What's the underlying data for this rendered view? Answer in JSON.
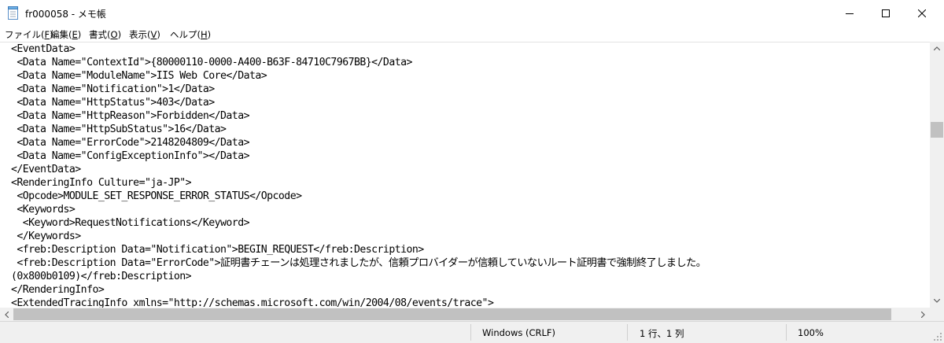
{
  "window": {
    "title": "fr000058 - メモ帳",
    "icon": "notepad-icon"
  },
  "menu": {
    "items": [
      {
        "label": "ファイル(",
        "key": "F",
        "suffix": ")"
      },
      {
        "label": "編集(",
        "key": "E",
        "suffix": ")"
      },
      {
        "label": "書式(",
        "key": "O",
        "suffix": ")"
      },
      {
        "label": "表示(",
        "key": "V",
        "suffix": ")"
      },
      {
        "label": "ヘルプ(",
        "key": "H",
        "suffix": ")"
      }
    ]
  },
  "editor": {
    "lines": [
      "<EventData>",
      " <Data Name=\"ContextId\">{80000110-0000-A400-B63F-84710C7967BB}</Data>",
      " <Data Name=\"ModuleName\">IIS Web Core</Data>",
      " <Data Name=\"Notification\">1</Data>",
      " <Data Name=\"HttpStatus\">403</Data>",
      " <Data Name=\"HttpReason\">Forbidden</Data>",
      " <Data Name=\"HttpSubStatus\">16</Data>",
      " <Data Name=\"ErrorCode\">2148204809</Data>",
      " <Data Name=\"ConfigExceptionInfo\"></Data>",
      "</EventData>",
      "<RenderingInfo Culture=\"ja-JP\">",
      " <Opcode>MODULE_SET_RESPONSE_ERROR_STATUS</Opcode>",
      " <Keywords>",
      "  <Keyword>RequestNotifications</Keyword>",
      " </Keywords>",
      " <freb:Description Data=\"Notification\">BEGIN_REQUEST</freb:Description>",
      " <freb:Description Data=\"ErrorCode\">証明書チェーンは処理されましたが、信頼プロバイダーが信頼していないルート証明書で強制終了しました。",
      "(0x800b0109)</freb:Description>",
      "</RenderingInfo>",
      "<ExtendedTracingInfo xmlns=\"http://schemas.microsoft.com/win/2004/08/events/trace\">"
    ]
  },
  "status": {
    "line_ending": "Windows (CRLF)",
    "position": "1 行、1 列",
    "zoom": "100%"
  }
}
